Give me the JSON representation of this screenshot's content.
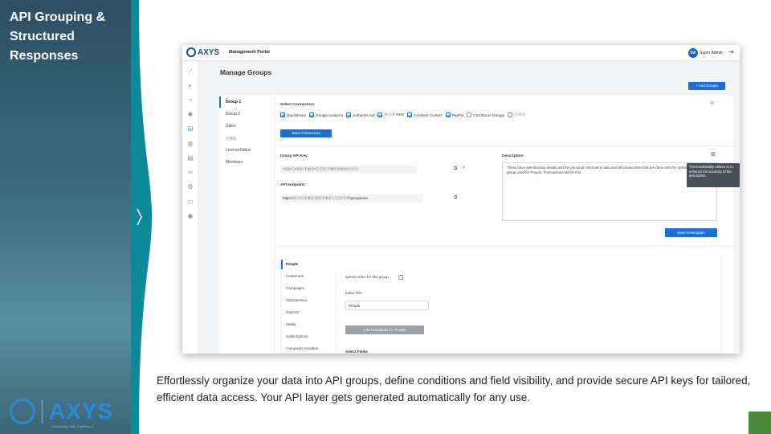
{
  "slide": {
    "title": "API Grouping & Structured Responses",
    "caption": "Effortlessly organize your data into API groups, define conditions and field visibility, and provide secure API keys for tailored, efficient data access. Your API layer gets generated automatically for any use.",
    "brand": {
      "name": "AXYS",
      "tagline": "Connecting Data, Enabling AI"
    },
    "colors": {
      "panel": "#3d6b80",
      "stripe": "#0d8a9a",
      "accent": "#1d6fd6",
      "corner": "#4a8a3c"
    }
  },
  "app": {
    "logo": "AXYS",
    "portal_title": "Management Portal",
    "user": {
      "initials": "SA",
      "name": "Super Admin"
    },
    "sidebar_icons": [
      "api-icon",
      "toggle-icon",
      "gauge-icon",
      "sun-icon",
      "database-icon",
      "globe-icon",
      "document-icon",
      "link-icon",
      "settings-icon",
      "file-icon",
      "user-icon"
    ],
    "page_title": "Manage Groups",
    "add_groups_label": "+ Add Groups",
    "groups": [
      "Group 1",
      "Group 2",
      "Sales",
      "ⓢⓦ1",
      "LicenseStatus",
      "Members"
    ],
    "select_connectors_label": "Select Connectors",
    "connectors": [
      {
        "name": "Quickbooks",
        "checked": true
      },
      {
        "name": "Google Analytics",
        "checked": true
      },
      {
        "name": "Authorize.net",
        "checked": true
      },
      {
        "name": "ⓜⓢⓟ RDS",
        "checked": true
      },
      {
        "name": "Constant Contact",
        "checked": true
      },
      {
        "name": "PayPal",
        "checked": true
      },
      {
        "name": "CSV/Excel Storage",
        "checked": false
      },
      {
        "name": "ⓒⓢⓥ",
        "checked": false
      }
    ],
    "save_connectors_label": "Save Connectors",
    "group_api_key_label": "Group API Key:",
    "group_api_key_value": "*ⓐⓑⓒ•ⓓⓔ:ⓕⓖⓗ*ⓘⓙⓚⓛⓜⓝⓞⓟⓠⓡⓢⓣ",
    "api_endpoint_label": "API endpoint:",
    "api_endpoint_value": "https://ⓧⓨⓩⓐⓑⓒⓓⓔⓕⓖⓗⓘⓙⓚⓛⓜ/groupindex",
    "description_label": "Description:",
    "description_text": "These have Membership details and the personal information data and all transactions that are done with the system. The main group used for People, Transactions will be this.",
    "tooltip_text": "This functionality utilizes AI to enhance the accuracy of the description.",
    "save_description_label": "Save Description",
    "sub_groups": [
      "People",
      "Customers",
      "Campaigns",
      "Transactions",
      "Reports",
      "Media",
      "Subscriptions",
      "Campaign Activities"
    ],
    "ignore_index_label": "Ignore Index for this group:",
    "index_title_label": "Index Title",
    "index_title_value": "People",
    "add_conditions_label": "Add Conditions for People",
    "select_fields_label": "Select Fields"
  }
}
